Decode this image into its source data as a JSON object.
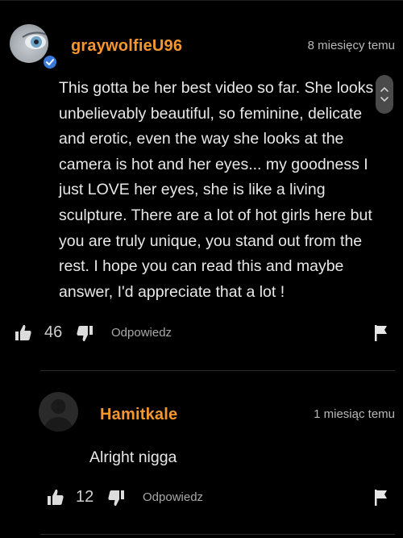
{
  "comments": [
    {
      "username": "graywolfieU96",
      "verified": true,
      "timestamp": "8 miesięcy temu",
      "text": "This gotta be her best video so far. She looks unbelievably beautiful, so feminine, delicate and erotic, even the way she looks at the camera is hot and her eyes... my goodness I just LOVE her eyes, she is like a living sculpture. There are a lot of hot girls here but you are truly unique, you stand out from the rest. I hope you can read this and maybe answer, I'd appreciate that a lot !",
      "likes": "46",
      "reply_label": "Odpowiedz"
    },
    {
      "username": "Hamitkale",
      "verified": false,
      "timestamp": "1 miesiąc temu",
      "text": "Alright nigga",
      "likes": "12",
      "reply_label": "Odpowiedz"
    }
  ],
  "icons": {
    "like": "thumbs-up-icon",
    "dislike": "thumbs-down-icon",
    "flag": "flag-icon",
    "verified": "checkmark-badge-icon",
    "collapse": "chevron-up-down-icon"
  },
  "colors": {
    "background": "#000000",
    "username": "#f5972f",
    "verified_badge": "#3b79d9",
    "text": "#e8e8e8"
  }
}
